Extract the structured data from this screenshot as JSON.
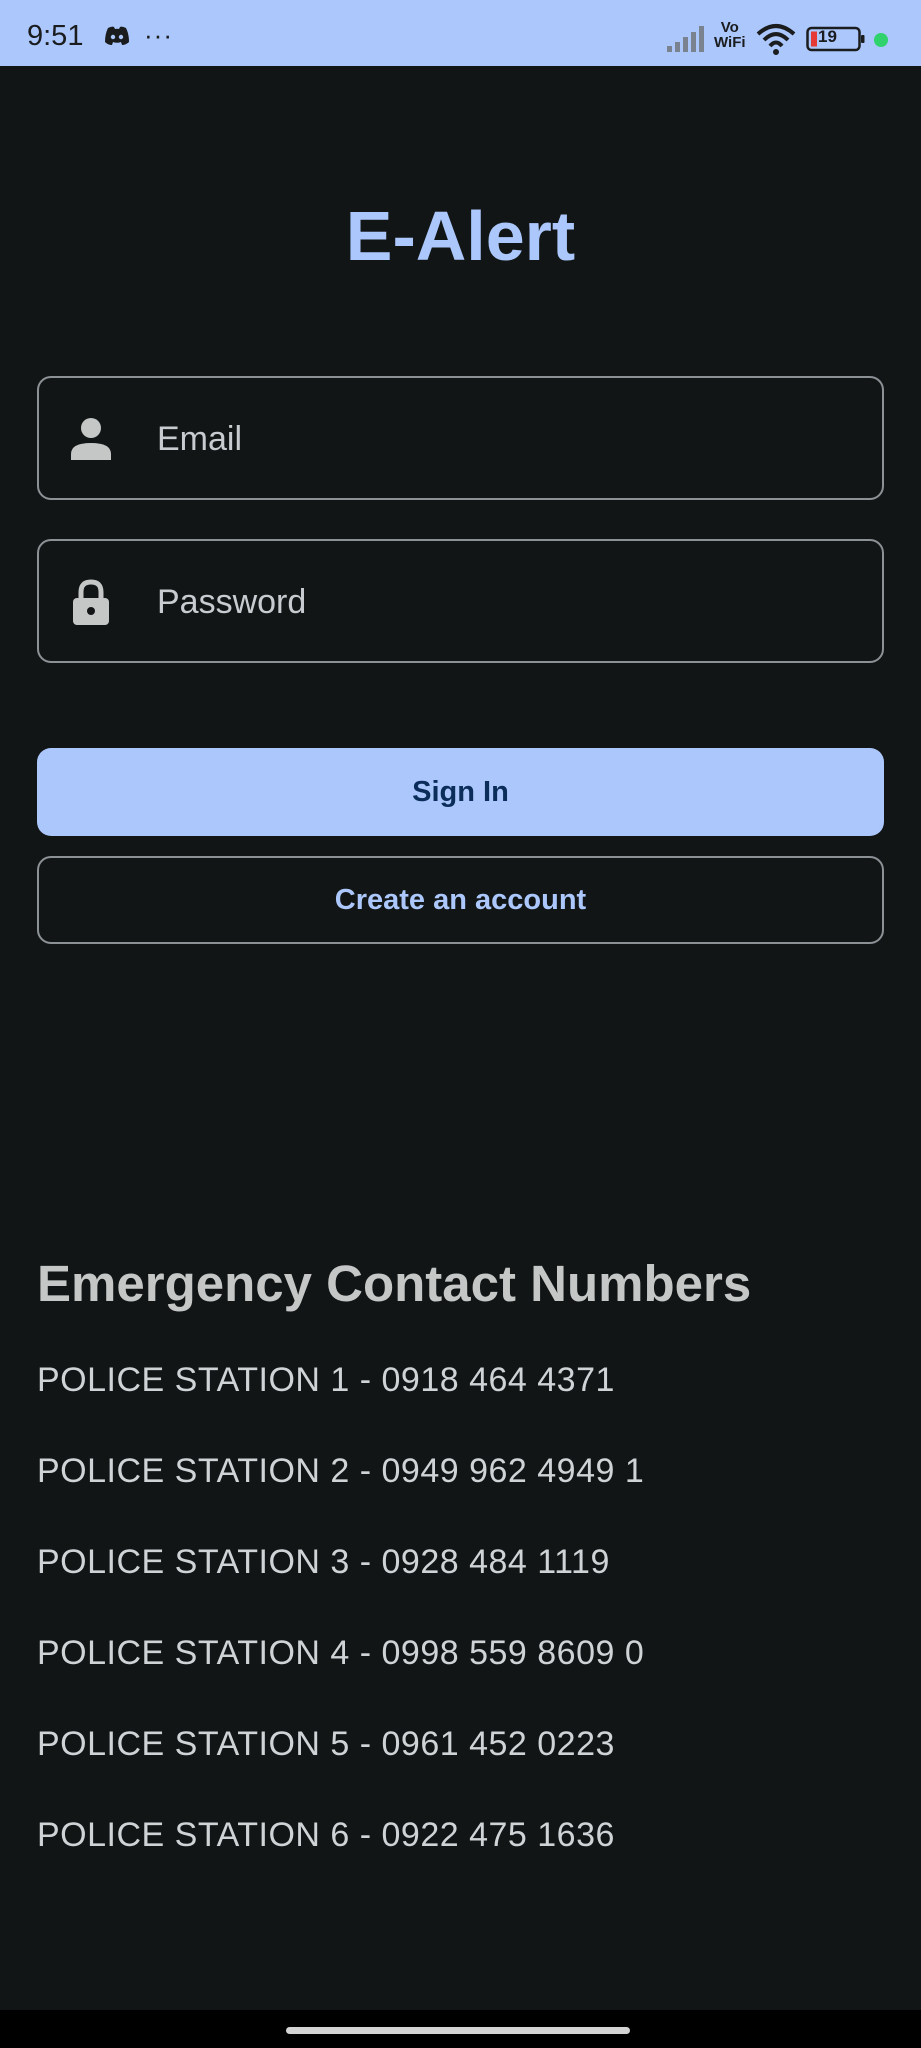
{
  "status_bar": {
    "time": "9:51",
    "more": "···",
    "vowifi_top": "Vo",
    "vowifi_bottom": "WiFi",
    "battery": "19",
    "icons": [
      "discord-icon",
      "signal-icon",
      "wifi-icon",
      "battery-icon"
    ],
    "bg_color": "#abc7fb"
  },
  "app": {
    "title": "E-Alert"
  },
  "form": {
    "email": {
      "placeholder": "Email",
      "value": "",
      "icon": "person-icon"
    },
    "password": {
      "placeholder": "Password",
      "value": "",
      "icon": "lock-icon"
    },
    "sign_in_label": "Sign In",
    "create_account_label": "Create an account"
  },
  "emergency": {
    "heading": "Emergency Contact Numbers",
    "contacts": [
      "POLICE STATION 1 - 0918 464 4371",
      "POLICE STATION 2 - 0949 962 4949 1",
      "POLICE STATION 3 - 0928 484 1119",
      "POLICE STATION 4 - 0998 559 8609 0",
      "POLICE STATION 5 - 0961 452 0223",
      "POLICE STATION 6 - 0922 475 1636"
    ]
  },
  "colors": {
    "background": "#121516",
    "accent": "#abc7fb",
    "primary_button_text": "#0b2d5a",
    "outline": "#8c9196"
  }
}
